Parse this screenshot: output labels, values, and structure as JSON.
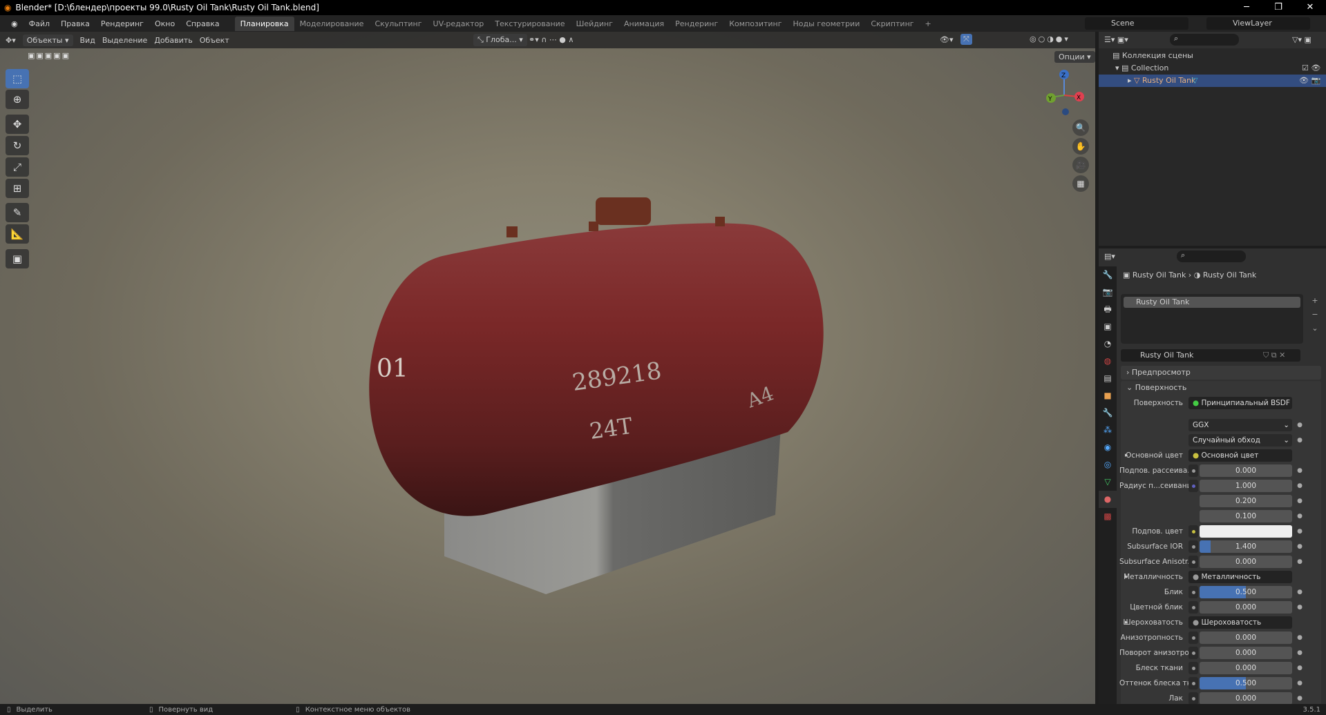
{
  "window": {
    "title": "Blender* [D:\\блендер\\проекты 99.0\\Rusty Oil Tank\\Rusty Oil Tank.blend]",
    "minimize": "─",
    "maximize": "❐",
    "close": "✕"
  },
  "menu": {
    "items": [
      "Файл",
      "Правка",
      "Рендеринг",
      "Окно",
      "Справка"
    ],
    "workspaces": [
      "Планировка",
      "Моделирование",
      "Скульптинг",
      "UV-редактор",
      "Текстурирование",
      "Шейдинг",
      "Анимация",
      "Рендеринг",
      "Композитинг",
      "Ноды геометрии",
      "Скриптинг",
      "+"
    ],
    "active_workspace": 0,
    "scene": "Scene",
    "view_layer": "ViewLayer"
  },
  "viewport": {
    "mode": "Объекты",
    "menus": [
      "Вид",
      "Выделение",
      "Добавить",
      "Объект"
    ],
    "orientation": "Глоба...",
    "options": "Опции",
    "tank_markings": [
      "01",
      "289218",
      "24T",
      "А4"
    ],
    "gizmo": {
      "z": "Z",
      "y": "Y",
      "x": "X"
    }
  },
  "outliner": {
    "scene_collection": "Коллекция сцены",
    "collection": "Collection",
    "object": "Rusty Oil Tank"
  },
  "properties": {
    "breadcrumb": [
      "Rusty Oil Tank",
      "Rusty Oil Tank"
    ],
    "material_slot": "Rusty Oil Tank",
    "material_name": "Rusty Oil Tank",
    "panels": {
      "preview": "Предпросмотр",
      "surface": "Поверхность"
    },
    "surface_label": "Поверхность",
    "surface_value": "Принципиальный BSDF",
    "distribution": "GGX",
    "subsurface_method": "Случайный обход",
    "rows": [
      {
        "label": "Основной цвет",
        "type": "link",
        "value": "Основной цвет",
        "color": "#c8c040"
      },
      {
        "label": "Подпов. рассеива...",
        "type": "num",
        "value": "0.000",
        "fill": 0
      },
      {
        "label": "Радиус п...сеивания",
        "type": "num",
        "value": "1.000",
        "fill": 0,
        "color": "#6060c0"
      },
      {
        "label": "",
        "type": "num",
        "value": "0.200",
        "fill": 0
      },
      {
        "label": "",
        "type": "num",
        "value": "0.100",
        "fill": 0
      },
      {
        "label": "Подпов. цвет",
        "type": "color",
        "value": "",
        "color": "#c8c040"
      },
      {
        "label": "Subsurface IOR",
        "type": "num",
        "value": "1.400",
        "fill": 0.12
      },
      {
        "label": "Subsurface Anisotr...",
        "type": "num",
        "value": "0.000",
        "fill": 0
      },
      {
        "label": "Металличность",
        "type": "link",
        "value": "Металличность"
      },
      {
        "label": "Блик",
        "type": "num",
        "value": "0.500",
        "fill": 0.5
      },
      {
        "label": "Цветной блик",
        "type": "num",
        "value": "0.000",
        "fill": 0
      },
      {
        "label": "Шероховатость",
        "type": "link",
        "value": "Шероховатость"
      },
      {
        "label": "Анизотропность",
        "type": "num",
        "value": "0.000",
        "fill": 0
      },
      {
        "label": "Поворот анизотро...",
        "type": "num",
        "value": "0.000",
        "fill": 0
      },
      {
        "label": "Блеск ткани",
        "type": "num",
        "value": "0.000",
        "fill": 0
      },
      {
        "label": "Оттенок блеска тк...",
        "type": "num",
        "value": "0.500",
        "fill": 0.5
      },
      {
        "label": "Лак",
        "type": "num",
        "value": "0.000",
        "fill": 0
      }
    ]
  },
  "status": {
    "select": "Выделить",
    "rotate": "Повернуть вид",
    "context": "Контекстное меню объектов",
    "version": "3.5.1"
  }
}
